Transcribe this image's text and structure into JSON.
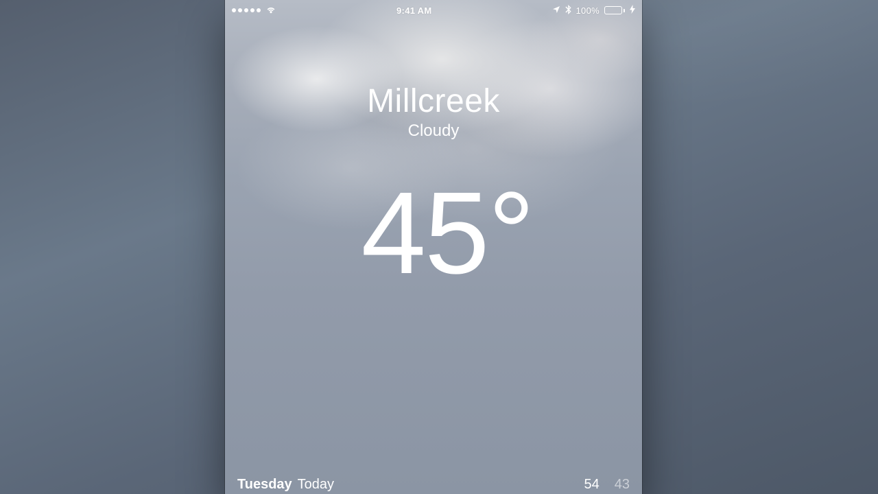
{
  "status_bar": {
    "time": "9:41 AM",
    "battery_pct": "100%"
  },
  "weather": {
    "city": "Millcreek",
    "condition": "Cloudy",
    "temp_display": "45°"
  },
  "today": {
    "day": "Tuesday",
    "label": "Today",
    "high": "54",
    "low": "43"
  }
}
